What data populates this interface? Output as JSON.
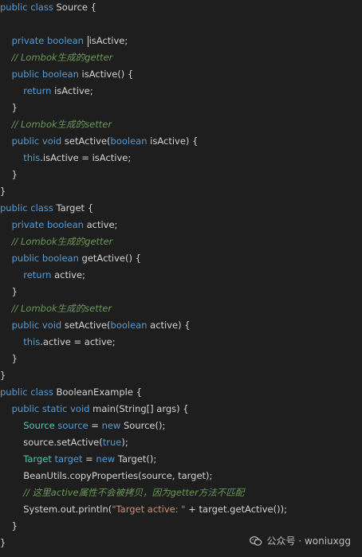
{
  "code": {
    "lines": [
      [
        {
          "k": "kw",
          "t": "public"
        },
        {
          "k": "tx",
          "t": " "
        },
        {
          "k": "kw",
          "t": "class"
        },
        {
          "k": "tx",
          "t": " Source {"
        }
      ],
      [],
      [
        {
          "k": "tx",
          "t": "    "
        },
        {
          "k": "kw",
          "t": "private"
        },
        {
          "k": "tx",
          "t": " "
        },
        {
          "k": "kw",
          "t": "boolean"
        },
        {
          "k": "tx",
          "t": " "
        },
        {
          "k": "cursor",
          "t": ""
        },
        {
          "k": "tx",
          "t": "isActive;"
        }
      ],
      [
        {
          "k": "tx",
          "t": "    "
        },
        {
          "k": "cm",
          "t": "// Lombok生成的getter"
        }
      ],
      [
        {
          "k": "tx",
          "t": "    "
        },
        {
          "k": "kw",
          "t": "public"
        },
        {
          "k": "tx",
          "t": " "
        },
        {
          "k": "kw",
          "t": "boolean"
        },
        {
          "k": "tx",
          "t": " isActive() {"
        }
      ],
      [
        {
          "k": "tx",
          "t": "        "
        },
        {
          "k": "kw",
          "t": "return"
        },
        {
          "k": "tx",
          "t": " isActive;"
        }
      ],
      [
        {
          "k": "tx",
          "t": "    }"
        }
      ],
      [
        {
          "k": "tx",
          "t": "    "
        },
        {
          "k": "cm",
          "t": "// Lombok生成的setter"
        }
      ],
      [
        {
          "k": "tx",
          "t": "    "
        },
        {
          "k": "kw",
          "t": "public"
        },
        {
          "k": "tx",
          "t": " "
        },
        {
          "k": "kw",
          "t": "void"
        },
        {
          "k": "tx",
          "t": " setActive("
        },
        {
          "k": "kw",
          "t": "boolean"
        },
        {
          "k": "tx",
          "t": " isActive) {"
        }
      ],
      [
        {
          "k": "tx",
          "t": "        "
        },
        {
          "k": "kw",
          "t": "this"
        },
        {
          "k": "tx",
          "t": ".isActive = isActive;"
        }
      ],
      [
        {
          "k": "tx",
          "t": "    }"
        }
      ],
      [
        {
          "k": "tx",
          "t": "}"
        }
      ],
      [
        {
          "k": "kw",
          "t": "public"
        },
        {
          "k": "tx",
          "t": " "
        },
        {
          "k": "kw",
          "t": "class"
        },
        {
          "k": "tx",
          "t": " Target {"
        }
      ],
      [
        {
          "k": "tx",
          "t": "    "
        },
        {
          "k": "kw",
          "t": "private"
        },
        {
          "k": "tx",
          "t": " "
        },
        {
          "k": "kw",
          "t": "boolean"
        },
        {
          "k": "tx",
          "t": " active;"
        }
      ],
      [
        {
          "k": "tx",
          "t": "    "
        },
        {
          "k": "cm",
          "t": "// Lombok生成的getter"
        }
      ],
      [
        {
          "k": "tx",
          "t": "    "
        },
        {
          "k": "kw",
          "t": "public"
        },
        {
          "k": "tx",
          "t": " "
        },
        {
          "k": "kw",
          "t": "boolean"
        },
        {
          "k": "tx",
          "t": " getActive() {"
        }
      ],
      [
        {
          "k": "tx",
          "t": "        "
        },
        {
          "k": "kw",
          "t": "return"
        },
        {
          "k": "tx",
          "t": " active;"
        }
      ],
      [
        {
          "k": "tx",
          "t": "    }"
        }
      ],
      [
        {
          "k": "tx",
          "t": "    "
        },
        {
          "k": "cm",
          "t": "// Lombok生成的setter"
        }
      ],
      [
        {
          "k": "tx",
          "t": "    "
        },
        {
          "k": "kw",
          "t": "public"
        },
        {
          "k": "tx",
          "t": " "
        },
        {
          "k": "kw",
          "t": "void"
        },
        {
          "k": "tx",
          "t": " setActive("
        },
        {
          "k": "kw",
          "t": "boolean"
        },
        {
          "k": "tx",
          "t": " active) {"
        }
      ],
      [
        {
          "k": "tx",
          "t": "        "
        },
        {
          "k": "kw",
          "t": "this"
        },
        {
          "k": "tx",
          "t": ".active = active;"
        }
      ],
      [
        {
          "k": "tx",
          "t": "    }"
        }
      ],
      [
        {
          "k": "tx",
          "t": "}"
        }
      ],
      [
        {
          "k": "kw",
          "t": "public"
        },
        {
          "k": "tx",
          "t": " "
        },
        {
          "k": "kw",
          "t": "class"
        },
        {
          "k": "tx",
          "t": " BooleanExample {"
        }
      ],
      [
        {
          "k": "tx",
          "t": "    "
        },
        {
          "k": "kw",
          "t": "public"
        },
        {
          "k": "tx",
          "t": " "
        },
        {
          "k": "kw",
          "t": "static"
        },
        {
          "k": "tx",
          "t": " "
        },
        {
          "k": "kw",
          "t": "void"
        },
        {
          "k": "tx",
          "t": " main(String[] args) {"
        }
      ],
      [
        {
          "k": "tx",
          "t": "        "
        },
        {
          "k": "ty",
          "t": "Source"
        },
        {
          "k": "tx",
          "t": " "
        },
        {
          "k": "kw",
          "t": "source"
        },
        {
          "k": "tx",
          "t": " = "
        },
        {
          "k": "kw",
          "t": "new"
        },
        {
          "k": "tx",
          "t": " Source();"
        }
      ],
      [
        {
          "k": "tx",
          "t": "        source.setActive("
        },
        {
          "k": "kw",
          "t": "true"
        },
        {
          "k": "tx",
          "t": ");"
        }
      ],
      [
        {
          "k": "tx",
          "t": "        "
        },
        {
          "k": "ty",
          "t": "Target"
        },
        {
          "k": "tx",
          "t": " "
        },
        {
          "k": "kw",
          "t": "target"
        },
        {
          "k": "tx",
          "t": " = "
        },
        {
          "k": "kw",
          "t": "new"
        },
        {
          "k": "tx",
          "t": " Target();"
        }
      ],
      [
        {
          "k": "tx",
          "t": "        BeanUtils.copyProperties(source, target);"
        }
      ],
      [
        {
          "k": "tx",
          "t": "        "
        },
        {
          "k": "cm",
          "t": "// 这里active属性不会被拷贝，因为getter方法不匹配"
        }
      ],
      [
        {
          "k": "tx",
          "t": "        System.out.println("
        },
        {
          "k": "st",
          "t": "\"Target active: \""
        },
        {
          "k": "tx",
          "t": " + target.getActive());"
        }
      ],
      [
        {
          "k": "tx",
          "t": "    }"
        }
      ],
      [
        {
          "k": "tx",
          "t": "}"
        }
      ]
    ]
  },
  "watermark": {
    "icon": "wechat-icon",
    "text": "公众号 · woniuxgg"
  }
}
